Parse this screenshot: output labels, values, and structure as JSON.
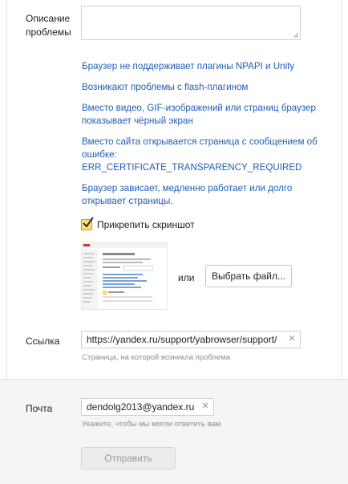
{
  "form": {
    "problem_label": "Описание проблемы",
    "suggestions": [
      "Браузер не поддерживает плагины NPAPI и Unity",
      "Возникают проблемы с flash-плагином",
      "Вместо видео, GIF-изображений или страниц браузер показывает чёрный экран",
      "Вместо сайта открывается страница с сообщением об ошибке: ERR_CERTIFICATE_TRANSPARENCY_REQUIRED",
      "Браузер зависает, медленно работает или долго открывает страницы."
    ],
    "attach_label": "Прикрепить скриншот",
    "attach_checked": true,
    "or_text": "или",
    "choose_file_label": "Выбрать файл...",
    "link_label": "Ссылка",
    "link_value": "https://yandex.ru/support/yabrowser/support/",
    "link_hint": "Страница, на которой возникла проблема",
    "email_label": "Почта",
    "email_value": "dendolg2013@yandex.ru",
    "email_hint": "Укажите, чтобы мы могли ответить вам",
    "submit_label": "Отправить"
  },
  "colors": {
    "link": "#1e5db7",
    "checkbox": "#ffe169",
    "gray_section": "#f6f5f3"
  }
}
